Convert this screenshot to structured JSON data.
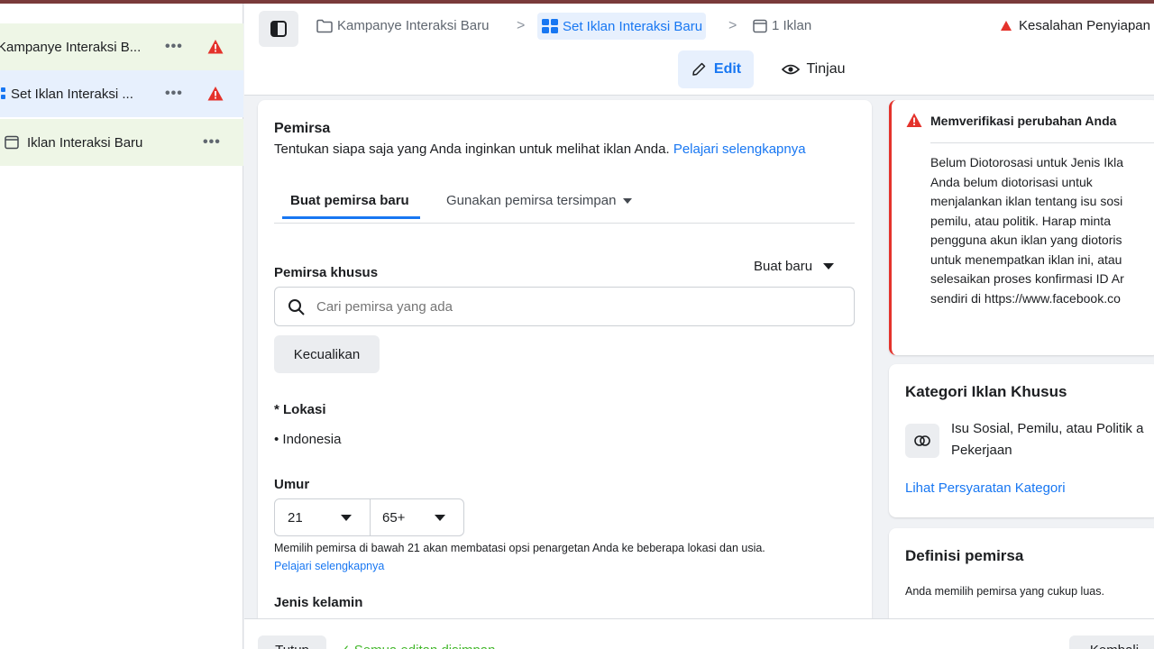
{
  "colors": {
    "accent": "#1877f2",
    "warning": "#e4322b",
    "success": "#42b72a"
  },
  "sidebar": {
    "items": [
      {
        "label": "Kampanye Interaksi B...",
        "more": "•••",
        "icon": "warning-icon"
      },
      {
        "label": "Set Iklan Interaksi ...",
        "more": "•••",
        "icon": "warning-icon"
      },
      {
        "label": "Iklan Interaksi Baru",
        "more": "•••",
        "icon": "ad-frame-icon"
      }
    ]
  },
  "topbar": {
    "breadcrumbs": [
      {
        "label": "Kampanye Interaksi Baru",
        "icon": "folder-icon"
      },
      {
        "label": "Set Iklan Interaksi Baru",
        "icon": "grid-icon"
      },
      {
        "label": "1 Iklan",
        "icon": "ad-frame-icon"
      }
    ],
    "error_label": "Kesalahan Penyiapan",
    "edit_label": "Edit",
    "review_label": "Tinjau"
  },
  "audience": {
    "title": "Pemirsa",
    "description": "Tentukan siapa saja yang Anda inginkan untuk melihat iklan Anda.",
    "learn_more": "Pelajari selengkapnya",
    "tabs": [
      "Buat pemirsa baru",
      "Gunakan pemirsa tersimpan"
    ],
    "custom_audience_label": "Pemirsa khusus",
    "create_new_label": "Buat baru",
    "search_placeholder": "Cari pemirsa yang ada",
    "exclude_label": "Kecualikan",
    "location_label": "* Lokasi",
    "location_value": "• Indonesia",
    "age_label": "Umur",
    "age_min": "21",
    "age_max": "65+",
    "age_note": "Memilih pemirsa di bawah 21 akan membatasi opsi penargetan Anda ke beberapa lokasi dan usia.",
    "age_note_link": "Pelajari selengkapnya",
    "gender_label": "Jenis kelamin"
  },
  "verify": {
    "title": "Memverifikasi perubahan Anda",
    "lines": [
      "Belum Diotorosasi untuk Jenis Ikla",
      "Anda belum diotorisasi untuk",
      "menjalankan iklan tentang isu sosi",
      "pemilu, atau politik. Harap minta",
      "pengguna akun iklan yang diotoris",
      "untuk menempatkan iklan ini, atau",
      "selesaikan proses konfirmasi ID Ar",
      "sendiri di https://www.facebook.co"
    ]
  },
  "category": {
    "title": "Kategori Iklan Khusus",
    "item_line1": "Isu Sosial, Pemilu, atau Politik a",
    "item_line2": "Pekerjaan",
    "link": "Lihat Persyaratan Kategori"
  },
  "definition": {
    "title": "Definisi pemirsa",
    "text": "Anda memilih pemirsa yang cukup luas."
  },
  "footer": {
    "close_label": "Tutup",
    "saved_label": "✓ Semua editan disimpan",
    "back_label": "Kembali"
  }
}
